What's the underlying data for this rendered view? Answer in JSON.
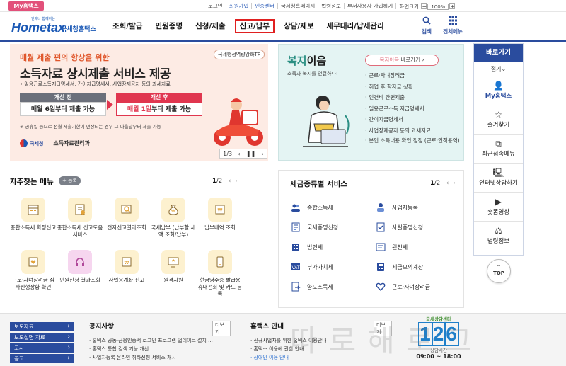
{
  "topbar": {
    "my_badge": "My홈택스",
    "links": [
      "로그인",
      "회원가입",
      "인증센터",
      "국세청홈페이지",
      "법령정보",
      "부서사용자 가입하기",
      "화면크기"
    ],
    "zoom": "100%"
  },
  "header": {
    "logo_text": "Hometax",
    "logo_sub": "국세청홈택스",
    "logo_tiny": "언제나 함께하는",
    "nav": [
      "조회/발급",
      "민원증명",
      "신청/제출",
      "신고/납부",
      "상담/제보",
      "세무대리/납세관리"
    ],
    "active_nav": "신고/납부",
    "search_label": "검색",
    "menu_label": "전체메뉴"
  },
  "banner": {
    "tag": "국세행정역량강화TF",
    "headline": "매월 제출 편의 향상을 위한",
    "title": "소득자료 상시제출 서비스 제공",
    "desc": "• 일용근로소득지급명세서, 간이지급명세서, 사업장제공자 등의 과세자료",
    "before_label": "개선 전",
    "before_text": "매월 6일부터 제출 가능",
    "after_label": "개선 후",
    "after_highlight": "매월 1일",
    "after_text": "부터 제출 가능",
    "note": "※ 공휴일 등으로 전월 제출기한이 연장되는 경우 그 다음날부터 제출 가능",
    "org_logo": "국세청",
    "org": "소득자료관리과",
    "pager": "1/3"
  },
  "welfare": {
    "title_a": "복지",
    "title_b": "이음",
    "subtitle": "소득과 복지를 연결하다!",
    "go_a": "복지이음",
    "go_b": " 바로가기 ›",
    "items": [
      "근로·자녀장려금",
      "취업 후 학자금 상환",
      "인건비 간편제출",
      "일용근로소득 지급명세서",
      "간이지급명세서",
      "사업장제공자 등의 과세자료"
    ],
    "last_item": "본인 소득내용 확인·정정 (근로·인적용역)"
  },
  "sidebar": {
    "title": "바로가기",
    "fold": "접기⌄",
    "items": [
      "My홈택스",
      "즐겨찾기",
      "최근접속메뉴",
      "인터넷상담하기",
      "숏폼영상",
      "법령정보"
    ],
    "top": "TOP"
  },
  "freq": {
    "title": "자주찾는 메뉴",
    "register": "+ 등록",
    "page": "1",
    "page_total": "/2",
    "items": [
      "종합소득세 확정신고",
      "종합소득세 신고도움 서비스",
      "전자신고결과조회",
      "국세납부 (납부할 세액 조회/납부)",
      "납부내역 조회",
      "근로·자녀장려금 심사진행상황 확인",
      "민원신청 결과조회",
      "사업용계좌 신고",
      "원격지원",
      "현금영수증 발급용 휴대전화 및 카드 등록"
    ]
  },
  "taxtypes": {
    "title": "세금종류별 서비스",
    "page": "1",
    "page_total": "/2",
    "items": [
      "종합소득세",
      "사업자등록",
      "국세증명신청",
      "사실증명신청",
      "법인세",
      "원천세",
      "부가가치세",
      "세금모의계산",
      "양도소득세",
      "근로·자녀장려금"
    ]
  },
  "bottom": {
    "list": [
      "보도자료",
      "보도설명 자료",
      "고시",
      "공고"
    ],
    "notice_title": "공지사항",
    "more": "더보기",
    "notices": [
      "홈택스 공동·금융인증서 로그인 프로그램 업데이트 설치 ...",
      "홈택스 통합 검색 기능 개선",
      "사업자등록 온라인 취하신청 서비스 개시"
    ],
    "info_title": "홈택스 안내",
    "infos": [
      "신규사업자를 위한 홈택스 이용안내",
      "홈택스 이용에 관한 안내"
    ],
    "info_link": "장애인 이용 안내",
    "cc_title": "국세상담센터",
    "cc_num": [
      "1",
      "2",
      "6"
    ],
    "cc_hours_label": "상담시간",
    "cc_hours": "09:00 ~ 18:00",
    "watermark": "따로해로그"
  }
}
